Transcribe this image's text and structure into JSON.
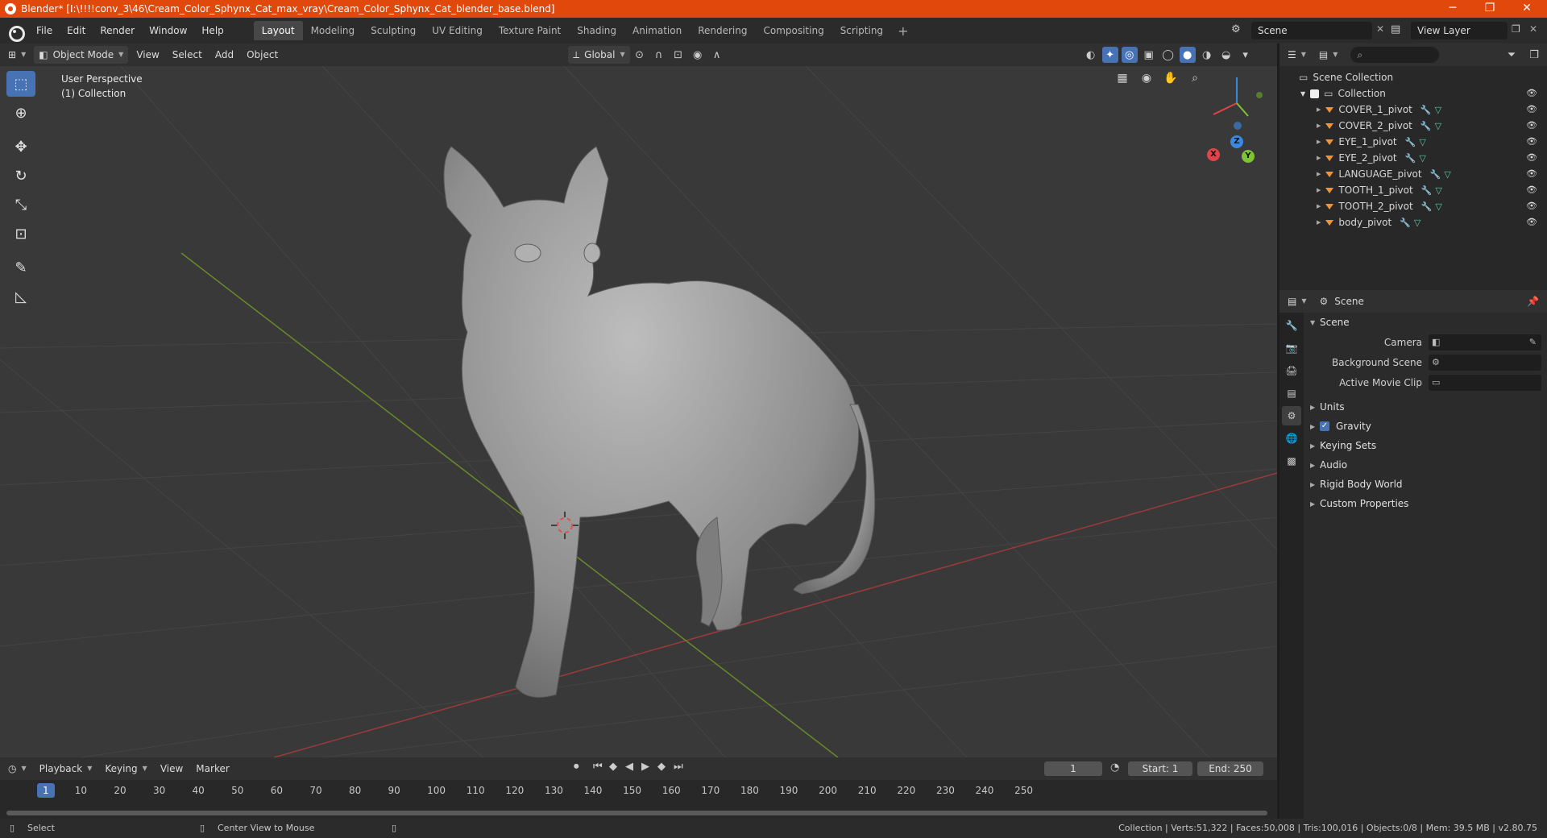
{
  "window": {
    "title": "Blender* [I:\\!!!!conv_3\\46\\Cream_Color_Sphynx_Cat_max_vray\\Cream_Color_Sphynx_Cat_blender_base.blend]",
    "minimize": "─",
    "maximize": "❐",
    "close": "✕"
  },
  "menu": [
    "File",
    "Edit",
    "Render",
    "Window",
    "Help"
  ],
  "workspaces": [
    "Layout",
    "Modeling",
    "Sculpting",
    "UV Editing",
    "Texture Paint",
    "Shading",
    "Animation",
    "Rendering",
    "Compositing",
    "Scripting"
  ],
  "active_workspace": "Layout",
  "scene_selector": "Scene",
  "view_layer": "View Layer",
  "viewport_header": {
    "mode": "Object Mode",
    "menus": [
      "View",
      "Select",
      "Add",
      "Object"
    ],
    "orientation": "Global"
  },
  "viewport": {
    "perspective": "User Perspective",
    "collection": "(1) Collection",
    "gizmo": {
      "x": "X",
      "y": "Y",
      "z": "Z"
    }
  },
  "outliner": {
    "root": "Scene Collection",
    "collection": "Collection",
    "objects": [
      "COVER_1_pivot",
      "COVER_2_pivot",
      "EYE_1_pivot",
      "EYE_2_pivot",
      "LANGUAGE_pivot",
      "TOOTH_1_pivot",
      "TOOTH_2_pivot",
      "body_pivot"
    ]
  },
  "properties": {
    "header": "Scene",
    "panel": "Scene",
    "fields": [
      {
        "label": "Camera"
      },
      {
        "label": "Background Scene"
      },
      {
        "label": "Active Movie Clip"
      }
    ],
    "subpanels": [
      "Units",
      "Gravity",
      "Keying Sets",
      "Audio",
      "Rigid Body World",
      "Custom Properties"
    ],
    "gravity_checked": true
  },
  "timeline": {
    "menus": [
      "Playback",
      "Keying",
      "View",
      "Marker"
    ],
    "current_frame": "1",
    "start_label": "Start:",
    "start": "1",
    "end_label": "End:",
    "end": "250",
    "ticks": [
      "1",
      "10",
      "20",
      "30",
      "40",
      "50",
      "60",
      "70",
      "80",
      "90",
      "100",
      "110",
      "120",
      "130",
      "140",
      "150",
      "160",
      "170",
      "180",
      "190",
      "200",
      "210",
      "220",
      "230",
      "240",
      "250"
    ]
  },
  "statusbar": {
    "left": "Select",
    "middle": "Center View to Mouse",
    "stats": "Collection | Verts:51,322 | Faces:50,008 | Tris:100,016 | Objects:0/8 | Mem: 39.5 MB | v2.80.75"
  },
  "colors": {
    "titlebar": "#e0480c",
    "accent": "#4772b3",
    "viewport_bg": "#393939",
    "x_axis": "#9b3a3a",
    "y_axis": "#6a8a2a",
    "gizmo_x": "#e2434b",
    "gizmo_y": "#7ec334",
    "gizmo_z": "#3b88e0"
  }
}
